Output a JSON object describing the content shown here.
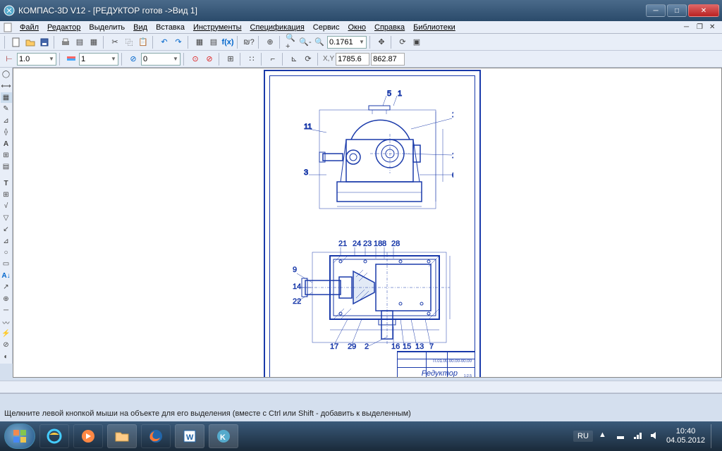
{
  "window": {
    "title": "КОМПАС-3D V12 - [РЕДУКТОР готов ->Вид 1]"
  },
  "menu": {
    "file": "Файл",
    "editor": "Редактор",
    "select": "Выделить",
    "view": "Вид",
    "insert": "Вставка",
    "tools": "Инструменты",
    "spec": "Спецификация",
    "service": "Сервис",
    "window": "Окно",
    "help": "Справка",
    "libs": "Библиотеки"
  },
  "toolbar1": {
    "zoom_value": "0.1761"
  },
  "toolbar2": {
    "linewidth": "1.0",
    "layer": "1",
    "style": "0",
    "coord_x": "1785.6",
    "coord_y": "862.87"
  },
  "drawing": {
    "title_num": "П.01.00.00.00-00.00",
    "title_name": "Редуктор",
    "title_scale": "1:2,5"
  },
  "status": {
    "hint": "Щелкните левой кнопкой мыши на объекте для его выделения (вместе с Ctrl или Shift - добавить к выделенным)"
  },
  "taskbar": {
    "lang": "RU",
    "time": "10:40",
    "date": "04.05.2012"
  }
}
